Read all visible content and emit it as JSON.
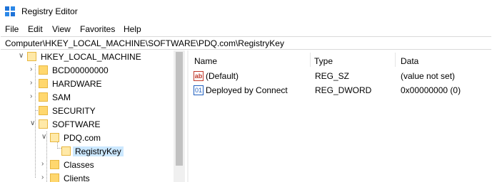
{
  "window": {
    "title": "Registry Editor"
  },
  "menu": [
    "File",
    "Edit",
    "View",
    "Favorites",
    "Help"
  ],
  "address": "Computer\\HKEY_LOCAL_MACHINE\\SOFTWARE\\PDQ.com\\RegistryKey",
  "tree": {
    "root": "HKEY_LOCAL_MACHINE",
    "items": [
      "BCD00000000",
      "HARDWARE",
      "SAM",
      "SECURITY",
      "SOFTWARE",
      "PDQ.com",
      "RegistryKey",
      "Classes",
      "Clients"
    ],
    "selected": "RegistryKey"
  },
  "list": {
    "headers": {
      "name": "Name",
      "type": "Type",
      "data": "Data"
    },
    "rows": [
      {
        "name": "(Default)",
        "type": "REG_SZ",
        "data": "(value not set)",
        "icon": "string-value-icon"
      },
      {
        "name": "Deployed by Connect",
        "type": "REG_DWORD",
        "data": "0x00000000 (0)",
        "icon": "dword-value-icon"
      }
    ]
  },
  "icons": {
    "string_glyph": "ab",
    "dword_glyph": "01"
  },
  "colors": {
    "selection": "#cce8ff",
    "folder": "#ffd76e"
  }
}
